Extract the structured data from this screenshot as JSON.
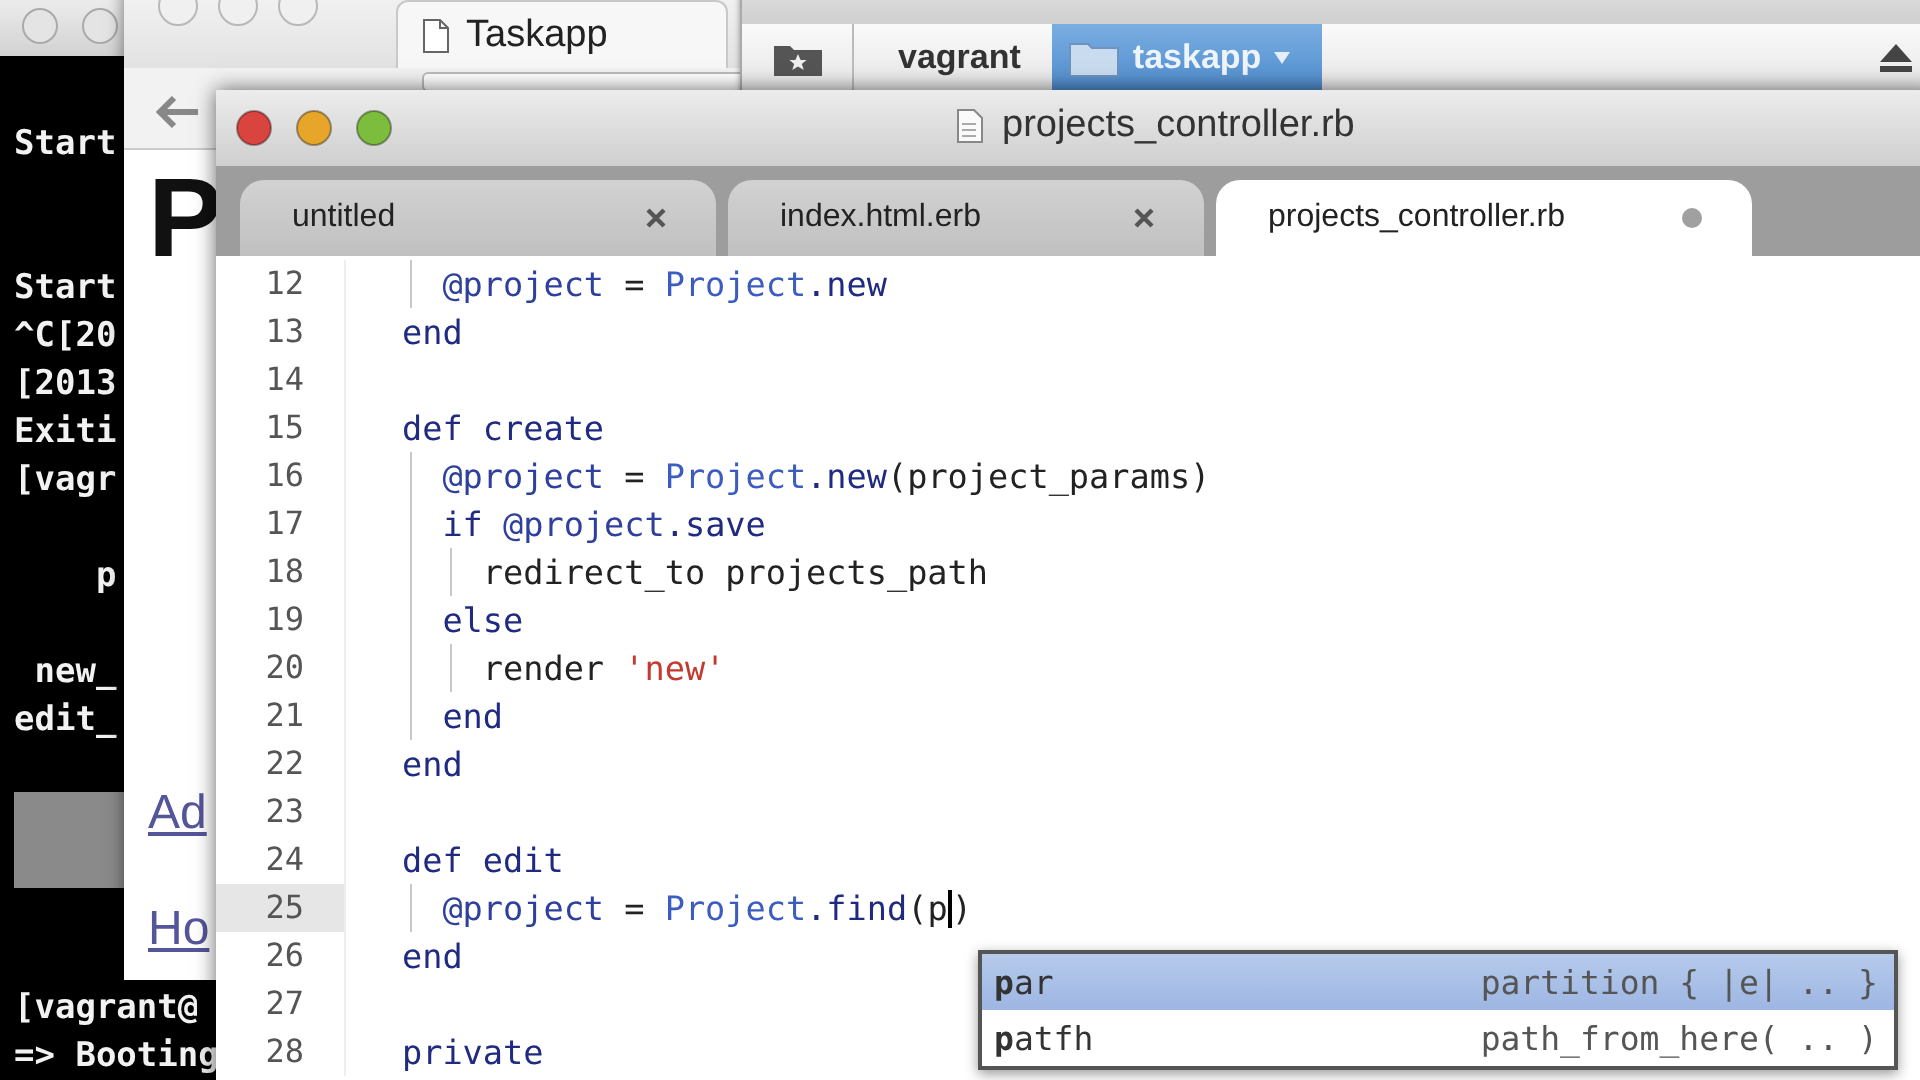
{
  "terminal": {
    "lines": [
      {
        "kind": "text",
        "text": "Start"
      },
      {
        "kind": "blank"
      },
      {
        "kind": "blank"
      },
      {
        "kind": "text",
        "text": "Start"
      },
      {
        "kind": "text",
        "text": "^C[20"
      },
      {
        "kind": "text",
        "text": "[2013"
      },
      {
        "kind": "text",
        "text": "Exiti"
      },
      {
        "kind": "text",
        "text": "[vagr"
      },
      {
        "kind": "blank"
      },
      {
        "kind": "text",
        "text": "    p"
      },
      {
        "kind": "blank"
      },
      {
        "kind": "text",
        "text": " new_"
      },
      {
        "kind": "text",
        "text": "edit_"
      },
      {
        "kind": "blank"
      },
      {
        "kind": "block"
      },
      {
        "kind": "blank"
      },
      {
        "kind": "blank"
      },
      {
        "kind": "text",
        "text": "[vagrant@"
      },
      {
        "kind": "text",
        "text": "=> Booting"
      }
    ]
  },
  "browser": {
    "tab_title": "Taskapp",
    "heading": "P",
    "links": [
      "Ad",
      "Ho"
    ]
  },
  "finder": {
    "path": [
      {
        "label": "vagrant",
        "selected": false
      },
      {
        "label": "taskapp",
        "selected": true
      }
    ]
  },
  "editor": {
    "title": "projects_controller.rb",
    "tabs": [
      {
        "label": "untitled",
        "selected": false,
        "modified": false
      },
      {
        "label": "index.html.erb",
        "selected": false,
        "modified": false
      },
      {
        "label": "projects_controller.rb",
        "selected": true,
        "modified": true
      }
    ],
    "lines": [
      {
        "number": "12",
        "current": false,
        "tokens": [
          {
            "kind": "indent"
          },
          {
            "kind": "ivar",
            "text": "@project"
          },
          {
            "kind": "plain",
            "text": " = "
          },
          {
            "kind": "const",
            "text": "Project"
          },
          {
            "kind": "method",
            "text": ".new"
          }
        ]
      },
      {
        "number": "13",
        "current": false,
        "tokens": [
          {
            "kind": "keyword",
            "text": "end"
          }
        ]
      },
      {
        "number": "14",
        "current": false
      },
      {
        "number": "15",
        "current": false,
        "tokens": [
          {
            "kind": "keyword",
            "text": "def"
          },
          {
            "kind": "defname",
            "text": " create"
          }
        ]
      },
      {
        "number": "16",
        "current": false,
        "tokens": [
          {
            "kind": "indent"
          },
          {
            "kind": "ivar",
            "text": "@project"
          },
          {
            "kind": "plain",
            "text": " = "
          },
          {
            "kind": "const",
            "text": "Project"
          },
          {
            "kind": "method",
            "text": ".new"
          },
          {
            "kind": "plain",
            "text": "(project_params)"
          }
        ]
      },
      {
        "number": "17",
        "current": false,
        "tokens": [
          {
            "kind": "indent"
          },
          {
            "kind": "keyword",
            "text": "if"
          },
          {
            "kind": "ivar",
            "text": " @project"
          },
          {
            "kind": "method",
            "text": ".save"
          }
        ]
      },
      {
        "number": "18",
        "current": false,
        "tokens": [
          {
            "kind": "indent"
          },
          {
            "kind": "indent"
          },
          {
            "kind": "plain",
            "text": "redirect_to projects_path"
          }
        ]
      },
      {
        "number": "19",
        "current": false,
        "tokens": [
          {
            "kind": "indent"
          },
          {
            "kind": "keyword",
            "text": "else"
          }
        ]
      },
      {
        "number": "20",
        "current": false,
        "tokens": [
          {
            "kind": "indent"
          },
          {
            "kind": "indent"
          },
          {
            "kind": "plain",
            "text": "render "
          },
          {
            "kind": "string",
            "text": "'new'"
          }
        ]
      },
      {
        "number": "21",
        "current": false,
        "tokens": [
          {
            "kind": "indent"
          },
          {
            "kind": "keyword",
            "text": "end"
          }
        ]
      },
      {
        "number": "22",
        "current": false,
        "tokens": [
          {
            "kind": "keyword",
            "text": "end"
          }
        ]
      },
      {
        "number": "23",
        "current": false
      },
      {
        "number": "24",
        "current": false,
        "tokens": [
          {
            "kind": "keyword",
            "text": "def"
          },
          {
            "kind": "defname",
            "text": " edit"
          }
        ]
      },
      {
        "number": "25",
        "current": true,
        "tokens": [
          {
            "kind": "indent"
          },
          {
            "kind": "ivar",
            "text": "@project"
          },
          {
            "kind": "plain",
            "text": " = "
          },
          {
            "kind": "const",
            "text": "Project"
          },
          {
            "kind": "method",
            "text": ".find"
          },
          {
            "kind": "plain",
            "text": "(p"
          },
          {
            "kind": "cursor"
          },
          {
            "kind": "plain",
            "text": ")"
          }
        ]
      },
      {
        "number": "26",
        "current": false,
        "tokens": [
          {
            "kind": "keyword",
            "text": "end"
          }
        ]
      },
      {
        "number": "27",
        "current": false
      },
      {
        "number": "28",
        "current": false,
        "tokens": [
          {
            "kind": "keyword",
            "text": "private"
          }
        ]
      }
    ],
    "autocomplete": {
      "items": [
        {
          "label": "**p**ar",
          "detail": "partition { |e| .. }",
          "selected": true
        },
        {
          "label": "**p**atfh",
          "detail": "path_from_here( .. )",
          "selected": false
        }
      ]
    }
  }
}
